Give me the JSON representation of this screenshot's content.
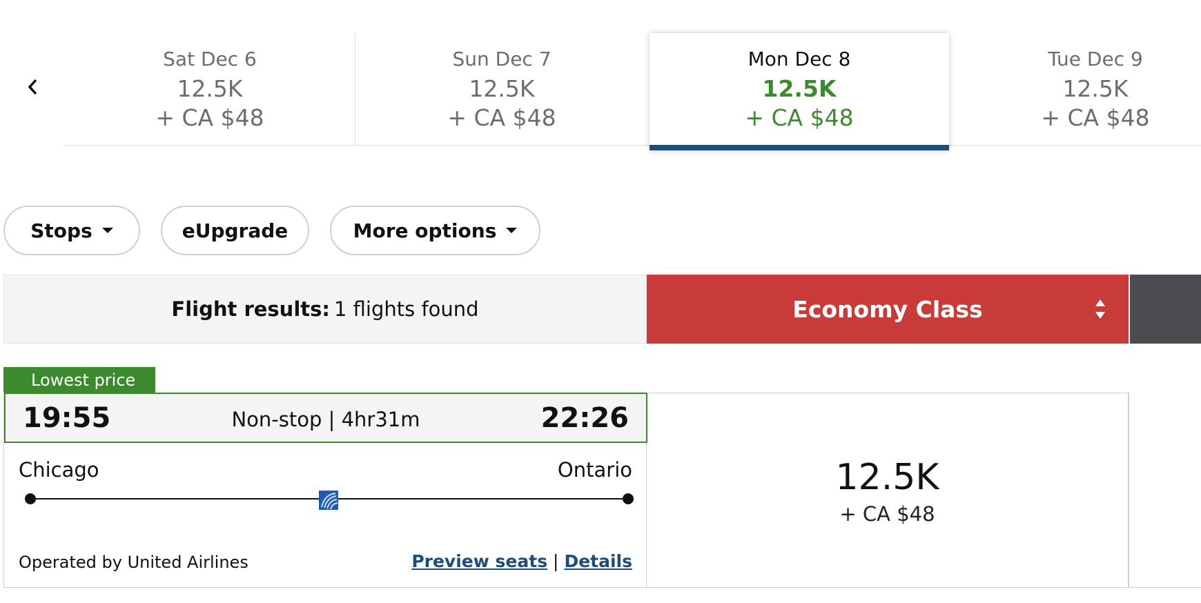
{
  "dates": [
    {
      "day": "Sat Dec 6",
      "points": "12.5K",
      "tax": "+ CA $48",
      "selected": false
    },
    {
      "day": "Sun Dec 7",
      "points": "12.5K",
      "tax": "+ CA $48",
      "selected": false
    },
    {
      "day": "Mon Dec 8",
      "points": "12.5K",
      "tax": "+ CA $48",
      "selected": true
    },
    {
      "day": "Tue Dec 9",
      "points": "12.5K",
      "tax": "+ CA $48",
      "selected": false
    }
  ],
  "filters": {
    "stops": "Stops",
    "eupgrade": "eUpgrade",
    "more_options": "More options"
  },
  "results": {
    "label": "Flight results:",
    "count_text": "1 flights found"
  },
  "cabin": {
    "label": "Economy Class"
  },
  "flight": {
    "badge": "Lowest price",
    "departure_time": "19:55",
    "arrival_time": "22:26",
    "duration": "Non-stop | 4hr31m",
    "origin": "Chicago",
    "destination": "Ontario",
    "operated_by": "Operated by United Airlines",
    "preview_seats": "Preview seats",
    "separator": "|",
    "details": "Details",
    "points": "12.5K",
    "tax": "+ CA $48"
  },
  "colors": {
    "accent_green": "#3c8a2e",
    "economy_red": "#c83b38",
    "selected_underline": "#1d4d78",
    "link_blue": "#1d4d78"
  }
}
